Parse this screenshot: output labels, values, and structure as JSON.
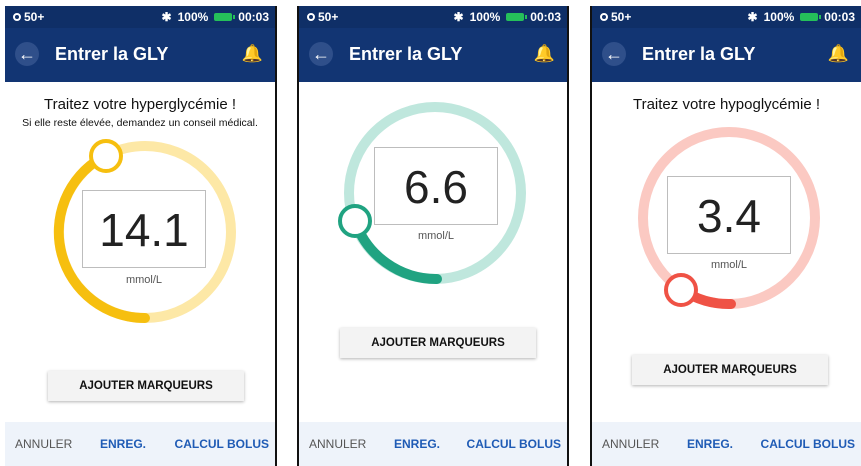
{
  "screens": [
    {
      "status": {
        "network": "50+",
        "battery": "100%",
        "time": "00:03"
      },
      "title": "Entrer la GLY",
      "headline": "Traitez votre hyperglycémie !",
      "subline": "Si elle reste élevée, demandez un conseil médical.",
      "value": "14.1",
      "unit": "mmol/L",
      "ring_color": "#fde8a6",
      "arc_color": "#f6bf0f",
      "button": "AJOUTER MARQUEURS",
      "footer": {
        "cancel": "ANNULER",
        "save": "ENREG.",
        "bolus": "CALCUL BOLUS"
      }
    },
    {
      "status": {
        "network": "50+",
        "battery": "100%",
        "time": "00:03"
      },
      "title": "Entrer la GLY",
      "value": "6.6",
      "unit": "mmol/L",
      "ring_color": "#bfe7dd",
      "arc_color": "#20a381",
      "button": "AJOUTER MARQUEURS",
      "footer": {
        "cancel": "ANNULER",
        "save": "ENREG.",
        "bolus": "CALCUL BOLUS"
      }
    },
    {
      "status": {
        "network": "50+",
        "battery": "100%",
        "time": "00:03"
      },
      "title": "Entrer la GLY",
      "headline": "Traitez votre hypoglycémie !",
      "value": "3.4",
      "unit": "mmol/L",
      "ring_color": "#fbc9c2",
      "arc_color": "#ef5245",
      "button": "AJOUTER MARQUEURS",
      "footer": {
        "cancel": "ANNULER",
        "save": "ENREG.",
        "bolus": "CALCUL BOLUS"
      }
    }
  ]
}
